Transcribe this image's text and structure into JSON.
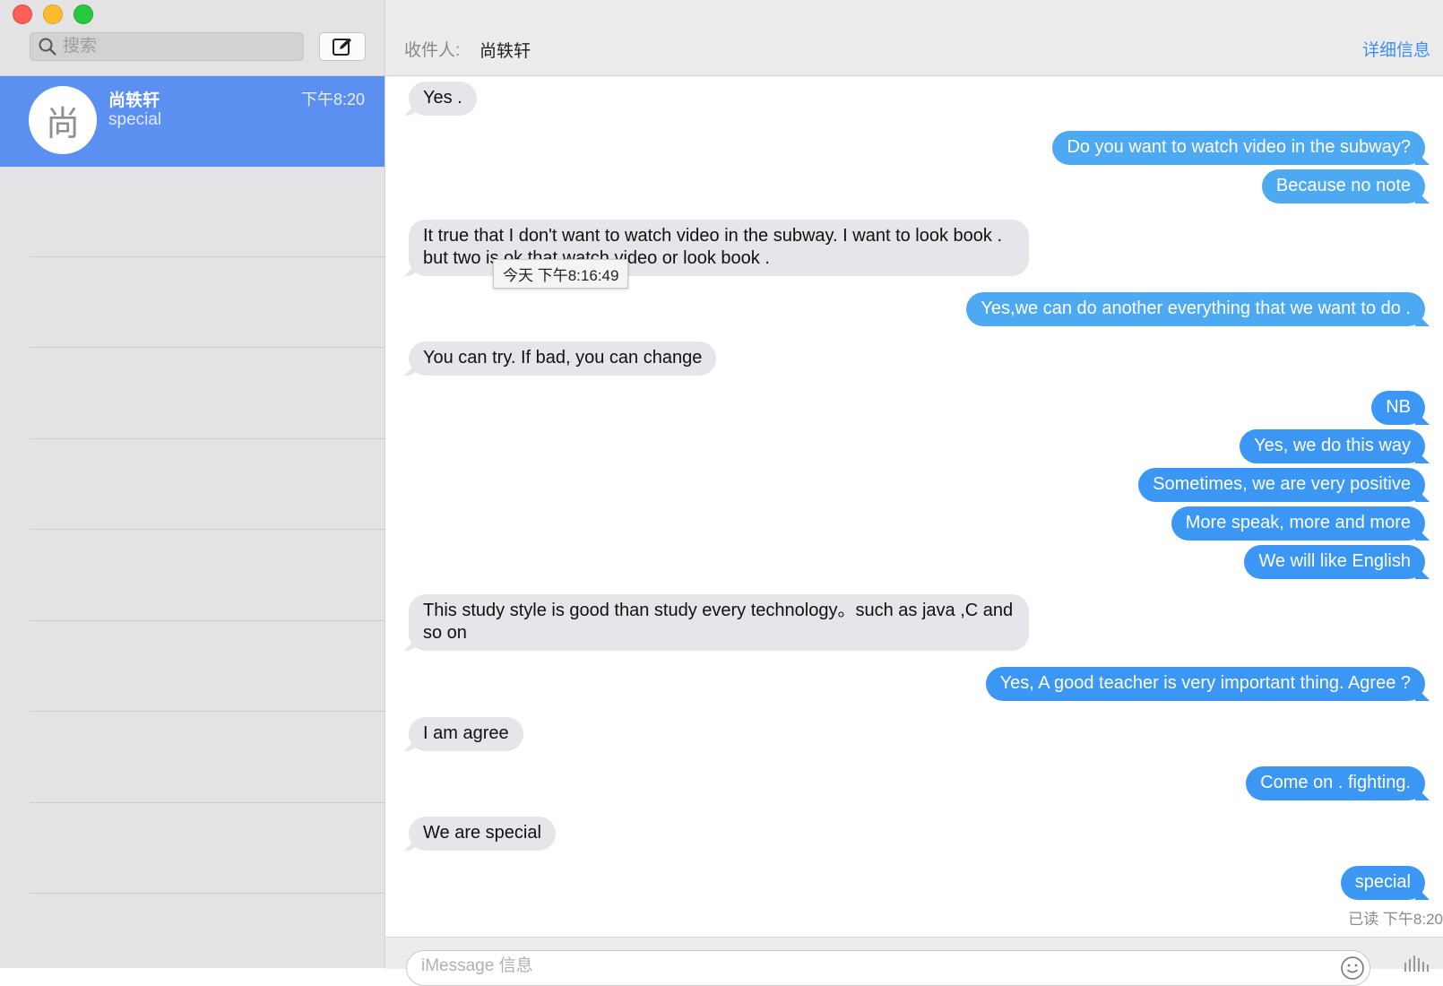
{
  "sidebar": {
    "search_placeholder": "搜索",
    "conversations": [
      {
        "avatar_initial": "尚",
        "name": "尚轶轩",
        "preview": "special",
        "time": "下午8:20"
      }
    ]
  },
  "header": {
    "to_label": "收件人:",
    "recipient": "尚轶轩",
    "details": "详细信息"
  },
  "messages": [
    {
      "from": "them",
      "text": "Yes ."
    },
    {
      "from": "me",
      "text": "Do you want to  watch video in the subway?"
    },
    {
      "from": "me",
      "text": "Because no note"
    },
    {
      "from": "them",
      "text": "It true  that  I don't want to watch video in the subway. I want to look book . but   two  is ok that watch video or look book ."
    },
    {
      "from": "me",
      "text": "Yes,we can do another everything that we want to do ."
    },
    {
      "from": "them",
      "text": "You can try. If bad, you can change"
    },
    {
      "from": "me",
      "text": "NB"
    },
    {
      "from": "me",
      "text": "Yes, we do this way"
    },
    {
      "from": "me",
      "text": "Sometimes, we are very positive"
    },
    {
      "from": "me",
      "text": "More speak, more and more"
    },
    {
      "from": "me",
      "text": "We will like English"
    },
    {
      "from": "them",
      "text": "This study style is good than study every technology。such as java ,C  and so on"
    },
    {
      "from": "me",
      "text": "Yes, A good teacher is very important thing. Agree ?"
    },
    {
      "from": "them",
      "text": "I am agree"
    },
    {
      "from": "me",
      "text": "Come on . fighting."
    },
    {
      "from": "them",
      "text": "We  are  special"
    },
    {
      "from": "me",
      "text": "special"
    }
  ],
  "tooltip": "今天 下午8:16:49",
  "read_receipt": "已读 下午8:20",
  "composer": {
    "placeholder": "iMessage 信息"
  },
  "colors": {
    "sidebar_selected": "#5b8ff0",
    "bubble_out": "#3b97f3",
    "bubble_in": "#e5e5ea",
    "link": "#3a8ef6"
  }
}
